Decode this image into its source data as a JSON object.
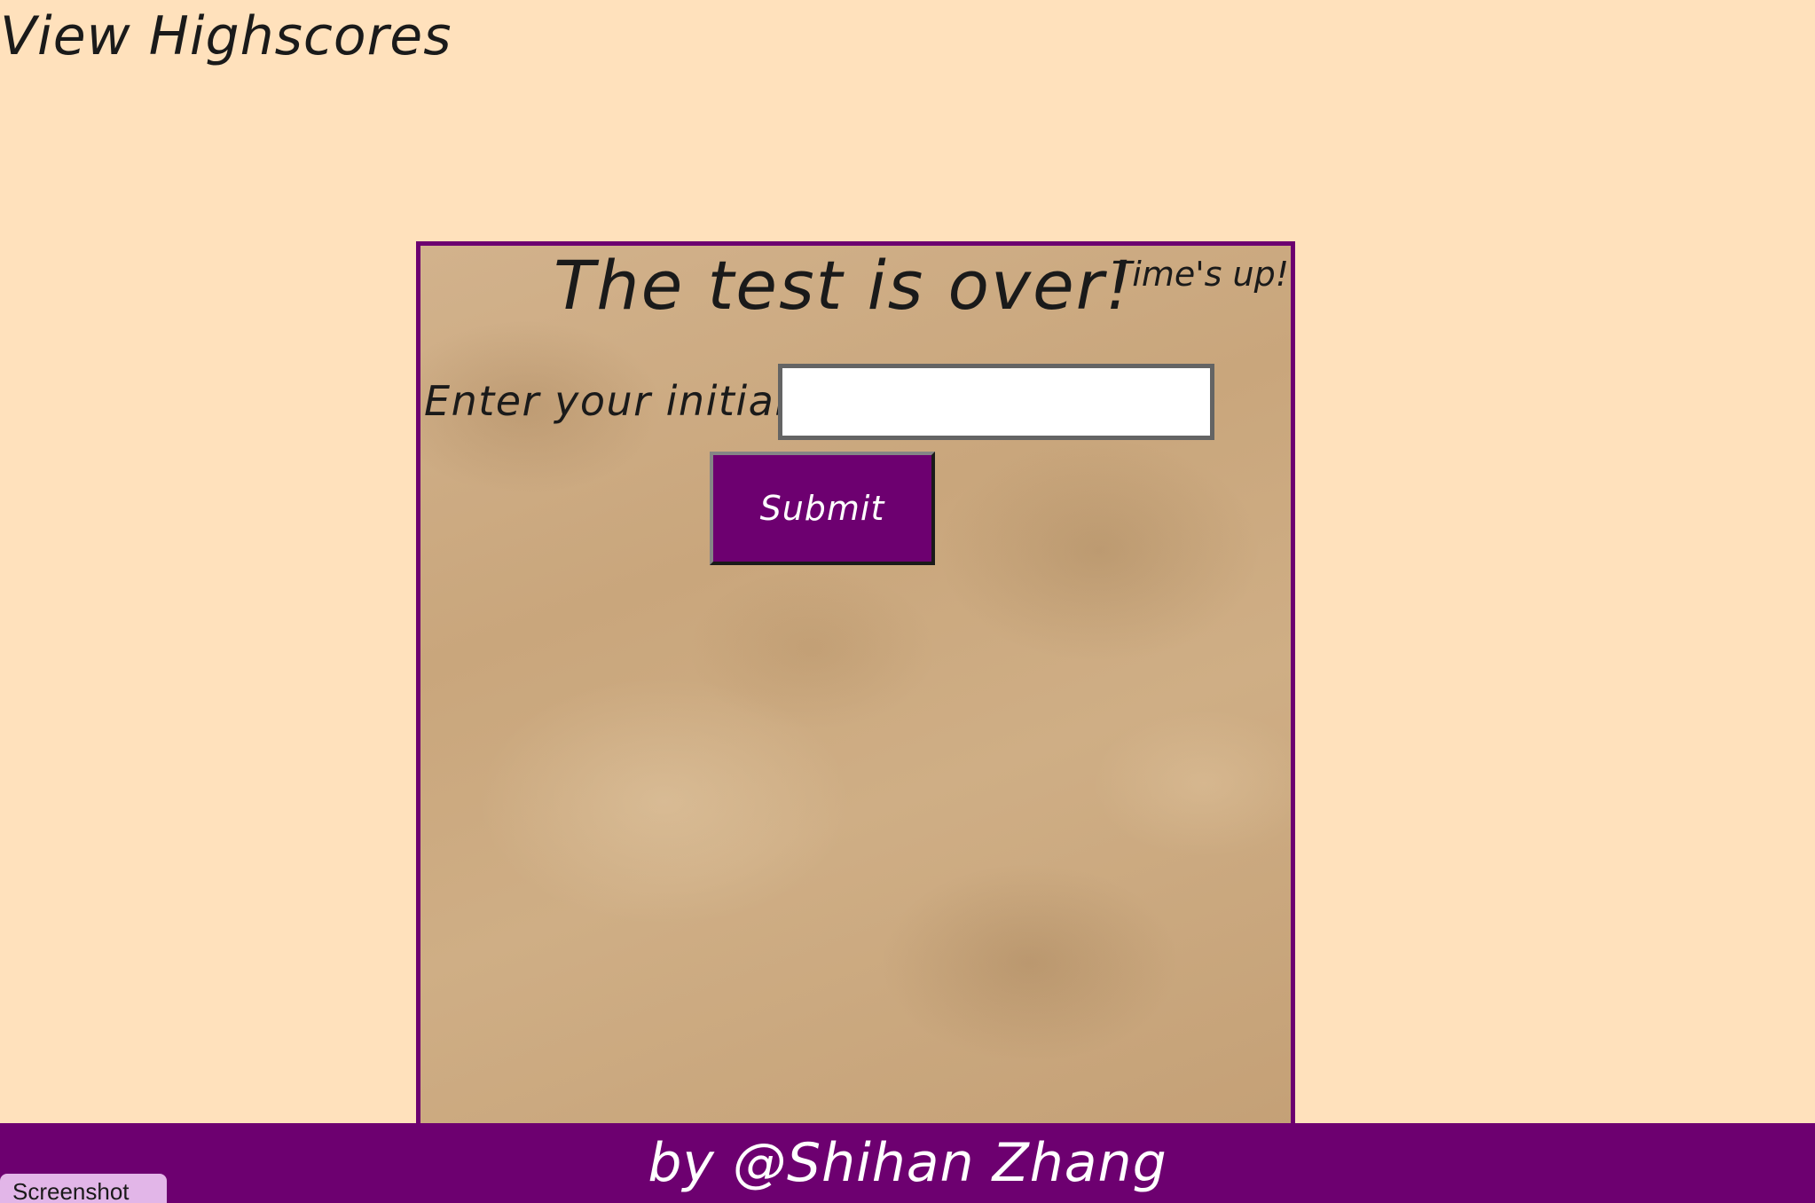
{
  "header": {
    "view_highscores_link": "View Highscores"
  },
  "quiz": {
    "title": "The test is over!",
    "timer_text": "Time's up!",
    "initials_label": "Enter your initials:",
    "initials_value": "",
    "submit_label": "Submit"
  },
  "footer": {
    "credit": "by @Shihan Zhang"
  },
  "overlay": {
    "screenshot_tab": "Screenshot"
  },
  "colors": {
    "page_background": "#FFE1BC",
    "accent_purple": "#6D0070",
    "card_parchment": "#C9A67C",
    "overlay_tab": "#E2B6E8"
  }
}
